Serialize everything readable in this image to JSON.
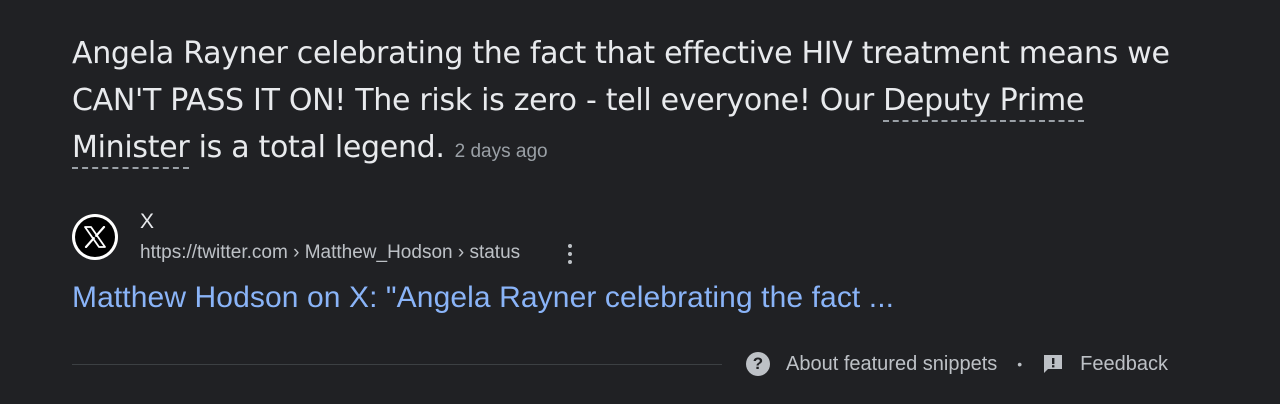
{
  "snippet": {
    "text_before": "Angela Rayner celebrating the fact that effective HIV treatment means we CAN'T PASS IT ON! The risk is zero - tell everyone! Our ",
    "term": "Deputy Prime Minister",
    "text_after": " is a total legend.",
    "date": "2 days ago"
  },
  "source": {
    "icon": "x-logo-icon",
    "site_name": "X",
    "url": "https://twitter.com › Matthew_Hodson › status"
  },
  "result": {
    "title": "Matthew Hodson on X: \"Angela Rayner celebrating the fact ..."
  },
  "footer": {
    "about_label": "About featured snippets",
    "separator": "•",
    "feedback_label": "Feedback"
  },
  "colors": {
    "background": "#202124",
    "link": "#8ab4f8",
    "text": "#e8eaed",
    "muted": "#9aa0a6"
  }
}
